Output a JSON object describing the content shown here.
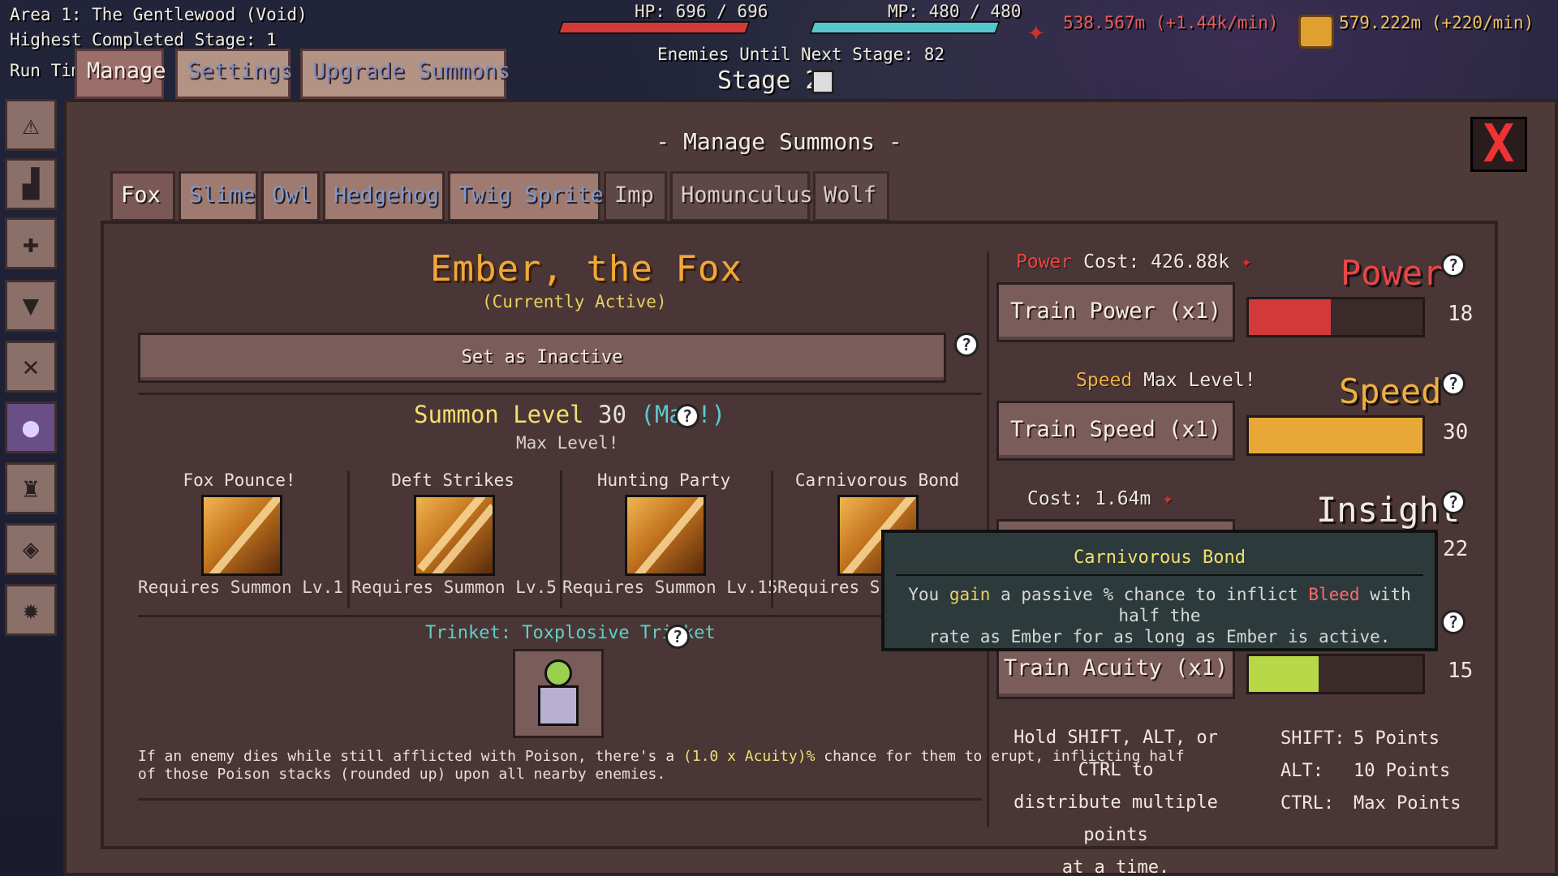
{
  "hud": {
    "area": "Area 1: The Gentlewood (Void)",
    "highest_stage": "Highest Completed Stage: 1",
    "run_time": "Run Time",
    "hp": "HP: 696 / 696",
    "mp": "MP: 480 / 480",
    "enemies_until_next": "Enemies Until Next Stage: 82",
    "stage": "Stage 2",
    "red_resource": "538.567m (+1.44k/min)",
    "gold_resource": "579.222m (+220/min)",
    "hp_fill": 1.0,
    "mp_fill": 1.0
  },
  "top_tabs": [
    "Manage",
    "Settings",
    "Upgrade Summons"
  ],
  "sidebar": [
    "warning-icon",
    "stats-icon",
    "sword-icon",
    "fox-head-icon",
    "crossed-tools-icon",
    "orb-icon",
    "trophy-icon",
    "map-icon",
    "gear-icon"
  ],
  "panel": {
    "title": "- Manage Summons -",
    "close": "X"
  },
  "summon_tabs": [
    {
      "label": "Fox",
      "state": "active"
    },
    {
      "label": "Slime",
      "state": "unlocked"
    },
    {
      "label": "Owl",
      "state": "unlocked"
    },
    {
      "label": "Hedgehog",
      "state": "unlocked"
    },
    {
      "label": "Twig Sprite",
      "state": "unlocked"
    },
    {
      "label": "Imp",
      "state": "locked"
    },
    {
      "label": "Homunculus",
      "state": "locked"
    },
    {
      "label": "Wolf",
      "state": "locked"
    }
  ],
  "summon": {
    "name": "Ember, the Fox",
    "status": "(Currently Active)",
    "toggle_button": "Set as Inactive",
    "level_prefix": "Summon Level ",
    "level_value": "30",
    "level_suffix": " (Max!)",
    "max_level": "Max Level!",
    "abilities": [
      {
        "name": "Fox Pounce!",
        "requirement": "Requires Summon Lv.1"
      },
      {
        "name": "Deft Strikes",
        "requirement": "Requires Summon Lv.5"
      },
      {
        "name": "Hunting Party",
        "requirement": "Requires Summon Lv.15"
      },
      {
        "name": "Carnivorous Bond",
        "requirement": "Requires Su"
      }
    ],
    "trinket_label": "Trinket: Toxplosive Trinket",
    "trinket_desc_1a": "If an enemy dies while still afflicted with Poison, there's a ",
    "trinket_desc_1b": "(1.0 x Acuity)%",
    "trinket_desc_1c": " chance for them to erupt, inflicting half",
    "trinket_desc_2": "of those Poison stacks (rounded up) upon all nearby enemies."
  },
  "stats": {
    "power": {
      "label": "Power",
      "cost_label": " Cost: 426.88k",
      "button": "Train Power (x1)",
      "value": "18",
      "fill": 0.47,
      "color": "#d23a3a",
      "label_color": "#e84848"
    },
    "speed": {
      "label": "Speed",
      "cost_label": " Max Level!",
      "button": "Train Speed (x1)",
      "value": "30",
      "fill": 1.0,
      "color": "#e8a838",
      "label_color": "#f0b040"
    },
    "insight": {
      "label": "Insight",
      "cost_label": " Cost: 1.64m",
      "value": "22"
    },
    "acuity": {
      "button": "Train Acuity (x1)",
      "value": "15",
      "fill": 0.4,
      "color": "#b8d848"
    }
  },
  "tooltip": {
    "title": "Carnivorous Bond",
    "line1a": "You ",
    "line1b": "gain",
    "line1c": " a passive % chance to inflict ",
    "line1d": "Bleed",
    "line1e": " with half the",
    "line2": "rate as Ember for as long as Ember is active."
  },
  "hints": {
    "line1": "Hold SHIFT, ALT, or CTRL to",
    "line2": "distribute multiple points",
    "line3": "at a time.",
    "keys": [
      {
        "key": "SHIFT:",
        "value": "5 Points"
      },
      {
        "key": "ALT:",
        "value": "10 Points"
      },
      {
        "key": "CTRL:",
        "value": "Max Points"
      }
    ]
  }
}
